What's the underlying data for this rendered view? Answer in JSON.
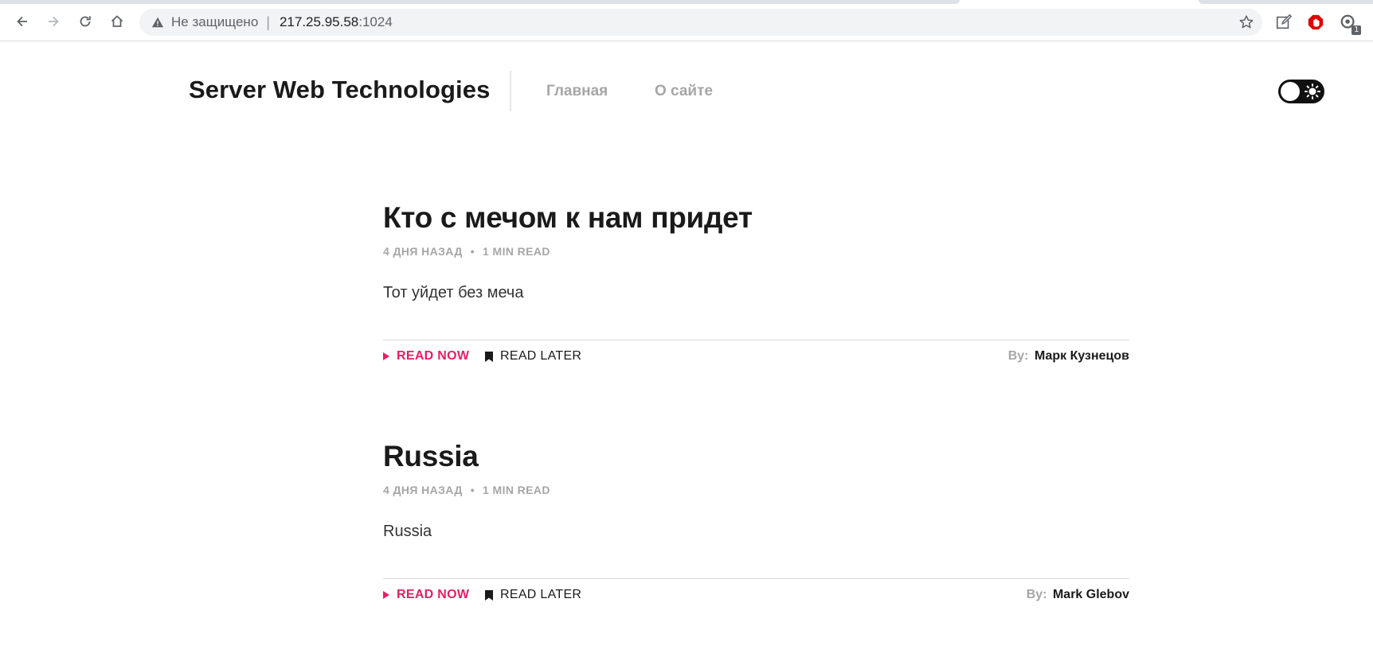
{
  "browser": {
    "security_label": "Не защищено",
    "separator": "|",
    "url_host": "217.25.95.58",
    "url_port": ":1024",
    "extension_badge": "1",
    "icons": [
      "back-icon",
      "forward-icon",
      "reload-icon",
      "home-icon",
      "warning-icon",
      "star-icon",
      "edit-icon",
      "adblock-icon",
      "extension-icon"
    ]
  },
  "site": {
    "title": "Server Web Technologies",
    "nav": [
      {
        "label": "Главная"
      },
      {
        "label": "О сайте"
      }
    ],
    "theme_toggle": {
      "state": "dark",
      "icon": "sun-icon"
    }
  },
  "posts": [
    {
      "title": "Кто с мечом к нам придет",
      "date": "4 ДНЯ НАЗАД",
      "dot": "•",
      "read_time": "1 MIN READ",
      "excerpt": "Тот уйдет без меча",
      "read_now": "READ NOW",
      "read_later": "READ LATER",
      "by_label": "By:",
      "author": "Марк Кузнецов"
    },
    {
      "title": "Russia",
      "date": "4 ДНЯ НАЗАД",
      "dot": "•",
      "read_time": "1 MIN READ",
      "excerpt": "Russia",
      "read_now": "READ NOW",
      "read_later": "READ LATER",
      "by_label": "By:",
      "author": "Mark Glebov"
    }
  ],
  "colors": {
    "accent": "#e91e63",
    "muted": "#a6a6a6",
    "text": "#1a1a1a"
  }
}
